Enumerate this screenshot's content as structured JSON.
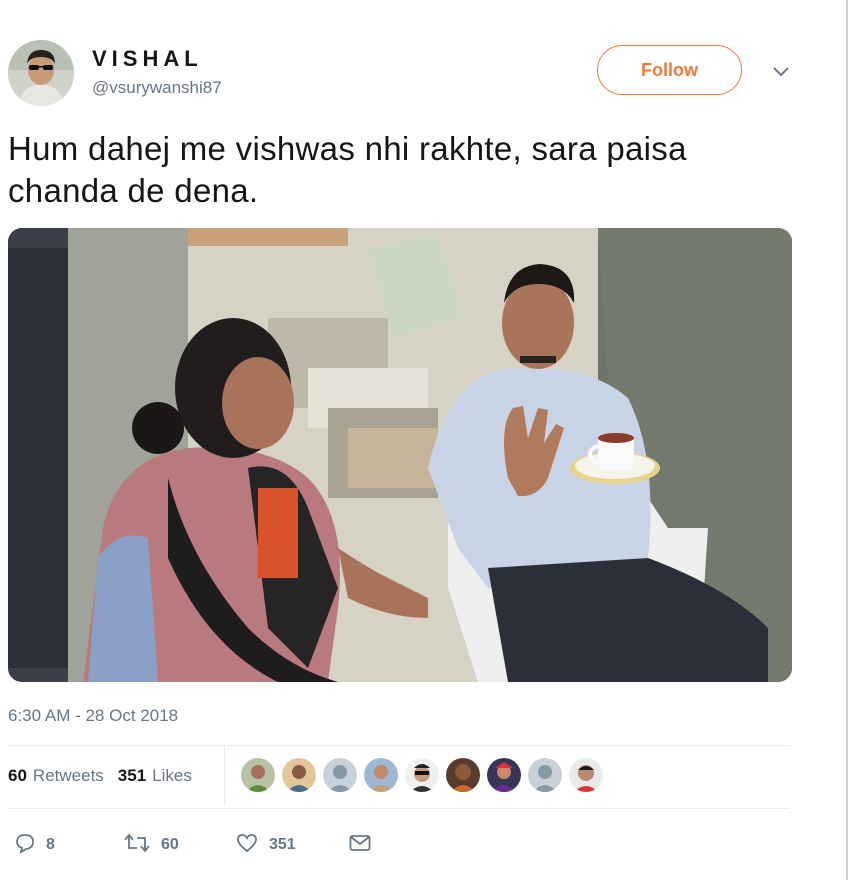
{
  "user": {
    "display_name": "VISHAL",
    "handle": "@vsurywanshi87"
  },
  "follow_label": "Follow",
  "tweet": {
    "text_line1": "Hum dahej me vishwas nhi rakhte, sara paisa",
    "text_line2": "chanda de dena."
  },
  "timestamp": "6:30 AM - 28 Oct 2018",
  "stats": {
    "retweets_count": "60",
    "retweets_label": "Retweets",
    "likes_count": "351",
    "likes_label": "Likes"
  },
  "liker_avatars": [
    "avatar-1",
    "avatar-2",
    "avatar-default",
    "avatar-4",
    "avatar-5",
    "avatar-6",
    "avatar-7",
    "avatar-default",
    "avatar-9"
  ],
  "actions": {
    "reply_count": "8",
    "retweet_count": "60",
    "like_count": "351"
  },
  "colors": {
    "accent": "#f07a3a",
    "secondary_text": "#657786",
    "divider": "#e6ecf0"
  }
}
